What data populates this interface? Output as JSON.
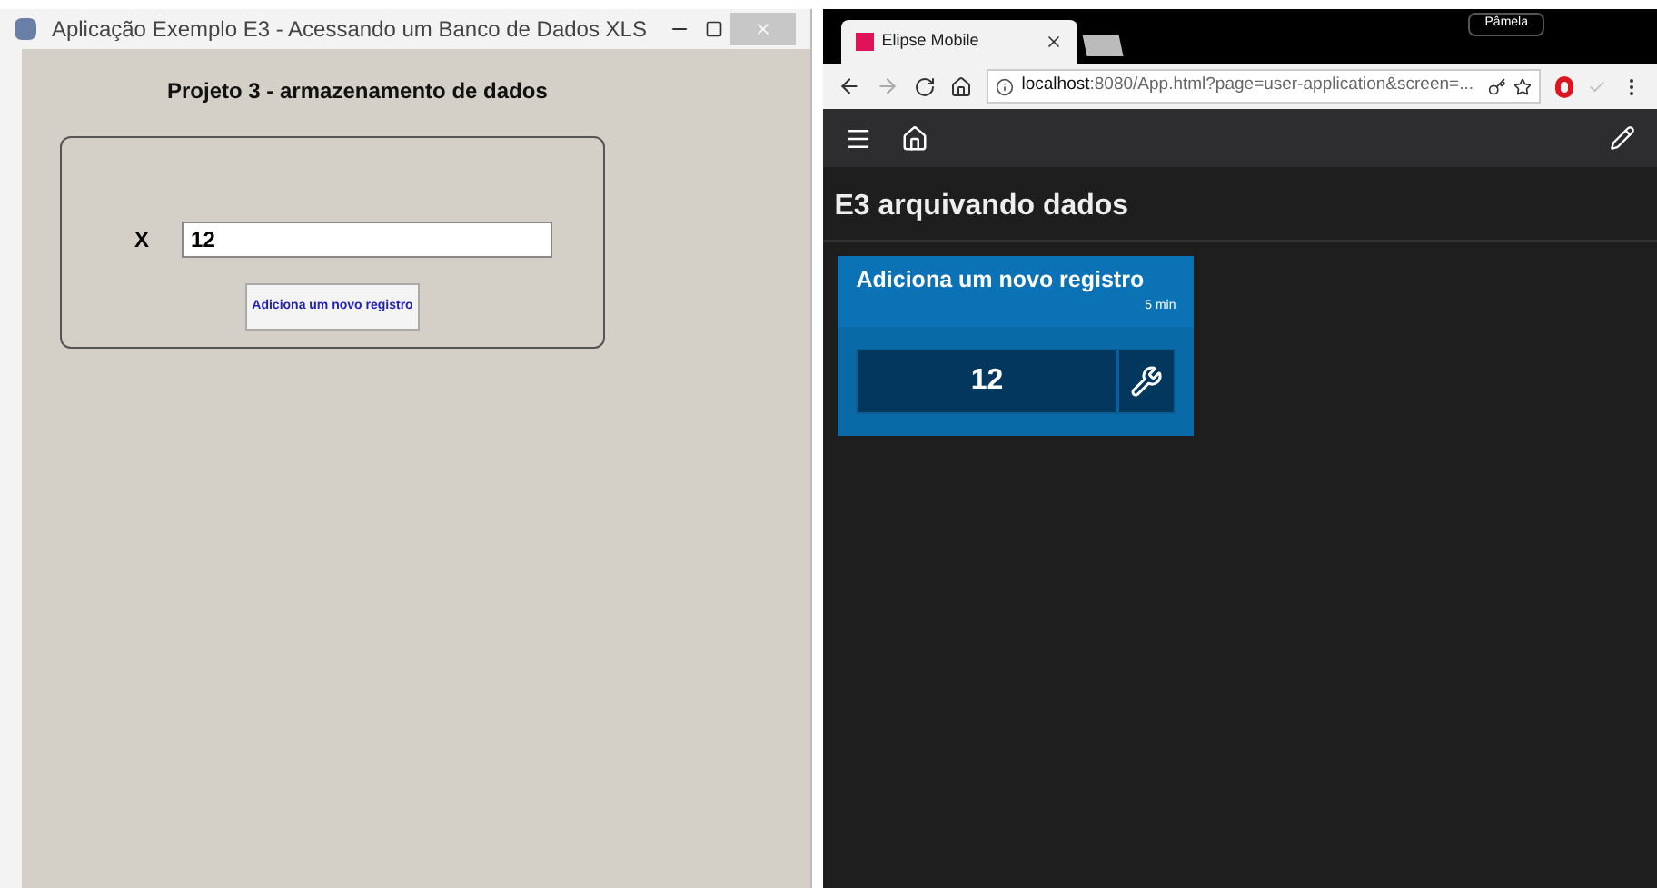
{
  "left_window": {
    "title": "Aplicação Exemplo E3 - Acessando um Banco de Dados XLS",
    "heading": "Projeto 3 - armazenamento de dados",
    "field_label": "X",
    "field_value": "12",
    "button": "Adiciona um novo registro"
  },
  "browser": {
    "user": "Pâmela",
    "tab_title": "Elipse Mobile",
    "address_host": "localhost",
    "address_rest": ":8080/App.html?page=user-application&screen=...",
    "page_title": "E3 arquivando dados",
    "card": {
      "title": "Adiciona um novo registro",
      "interval": "5 min",
      "value": "12"
    }
  }
}
